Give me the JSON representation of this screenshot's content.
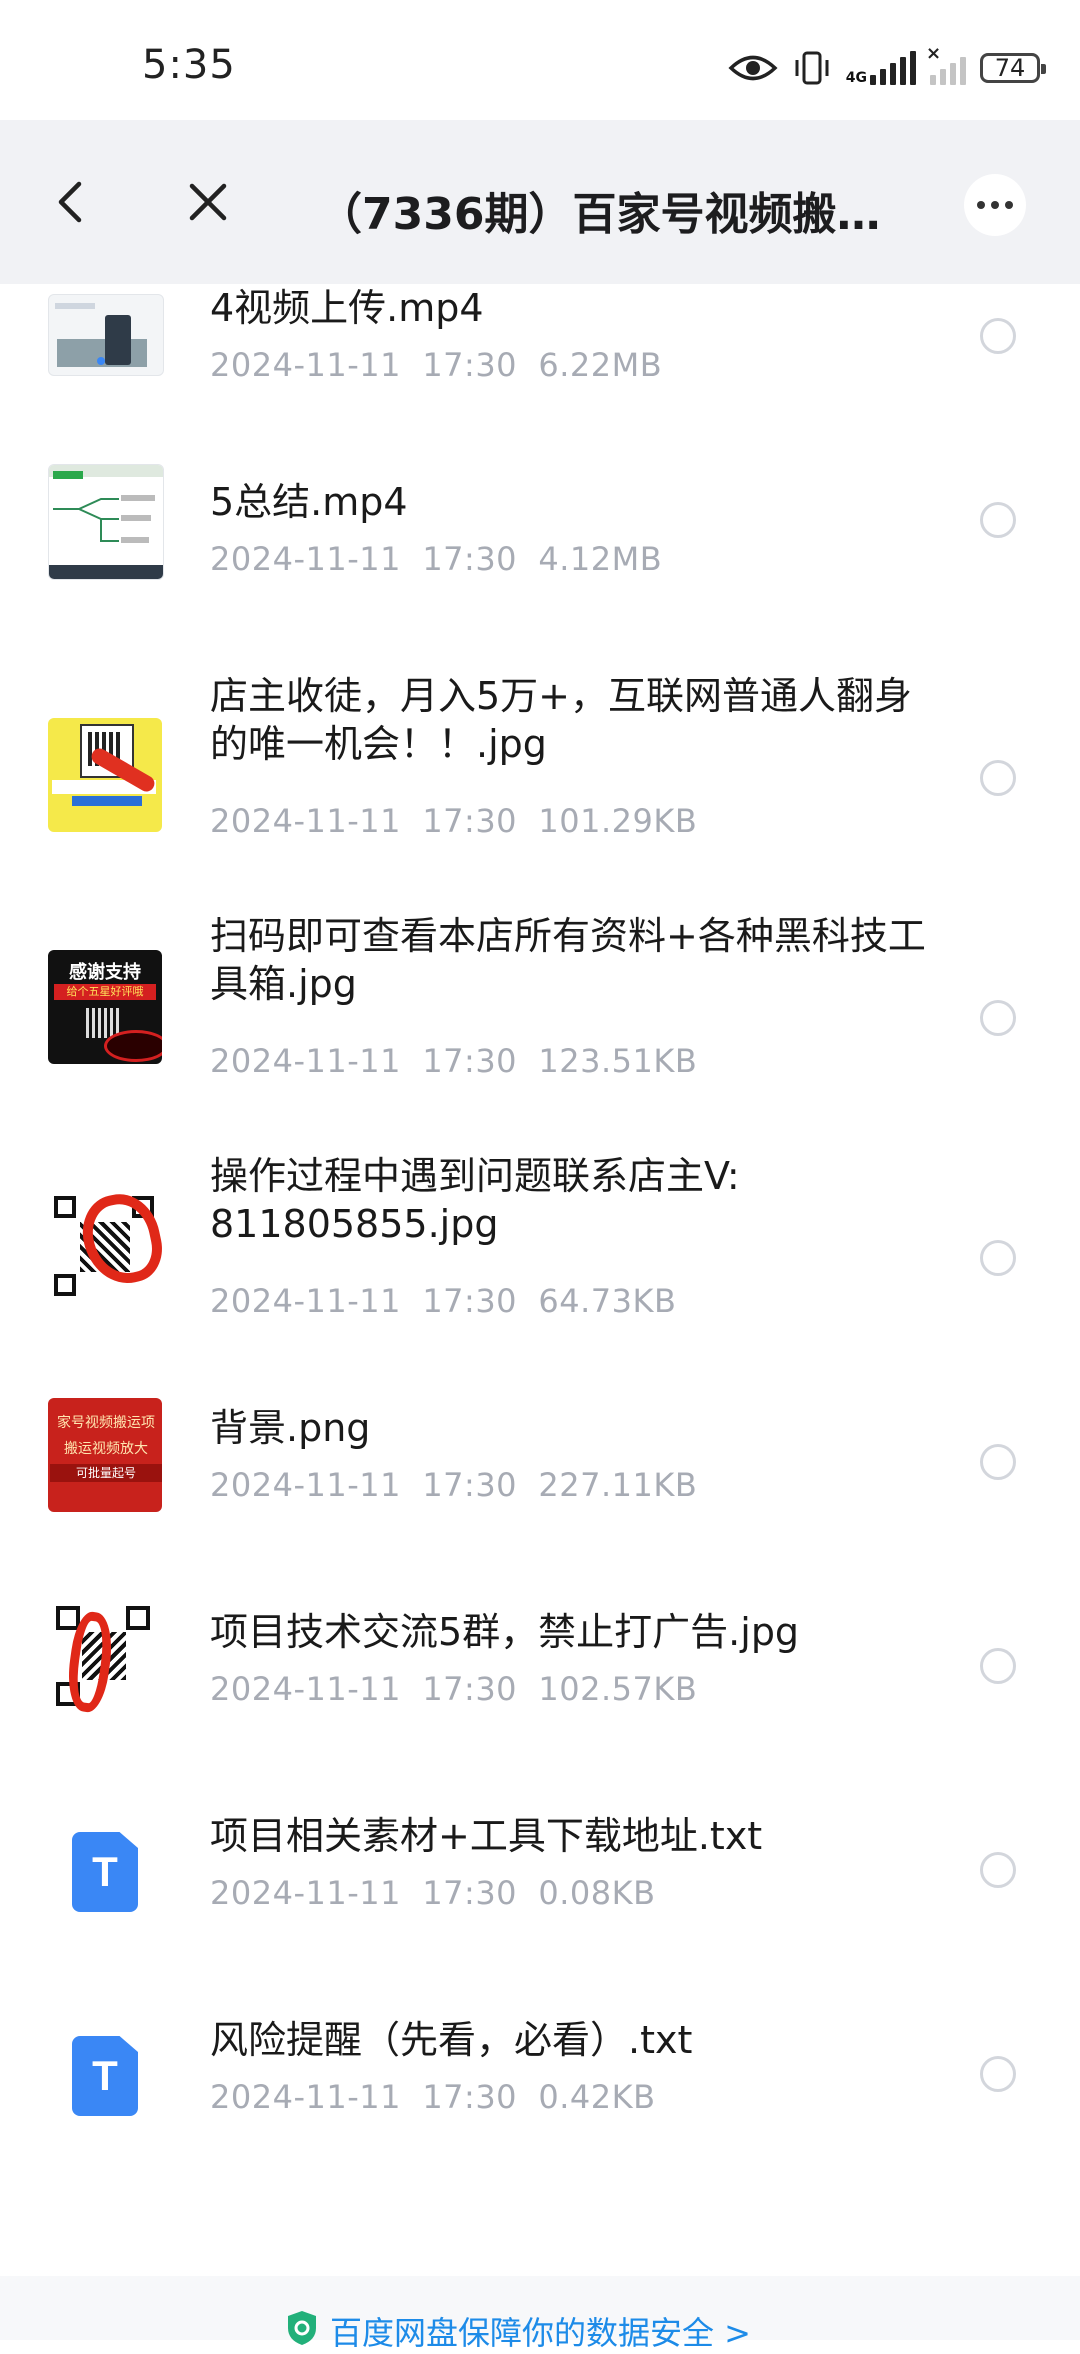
{
  "status": {
    "time": "5:35",
    "network": "4G",
    "battery": "74"
  },
  "header": {
    "title": "（7336期）百家号视频搬运..."
  },
  "files": [
    {
      "name": "4视频上传.mp4",
      "date": "2024-11-11",
      "time": "17:30",
      "size": "6.22MB",
      "thumb": "video-thumbnail"
    },
    {
      "name": "5总结.mp4",
      "date": "2024-11-11",
      "time": "17:30",
      "size": "4.12MB",
      "thumb": "video-thumbnail"
    },
    {
      "name": "店主收徒，月入5万+，互联网普通人翻身的唯一机会！！.jpg",
      "date": "2024-11-11",
      "time": "17:30",
      "size": "101.29KB",
      "thumb": "image-thumbnail"
    },
    {
      "name": "扫码即可查看本店所有资料+各种黑科技工具箱.jpg",
      "date": "2024-11-11",
      "time": "17:30",
      "size": "123.51KB",
      "thumb": "image-thumbnail",
      "thumb_text": [
        "感谢支持",
        "给个五星好评哦"
      ]
    },
    {
      "name": "操作过程中遇到问题联系店主V: 811805855.jpg",
      "date": "2024-11-11",
      "time": "17:30",
      "size": "64.73KB",
      "thumb": "qr-thumbnail"
    },
    {
      "name": "背景.png",
      "date": "2024-11-11",
      "time": "17:30",
      "size": "227.11KB",
      "thumb": "image-thumbnail",
      "thumb_text": [
        "家号视频搬运项",
        "搬运视频放大",
        "可批量起号"
      ]
    },
    {
      "name": "项目技术交流5群，禁止打广告.jpg",
      "date": "2024-11-11",
      "time": "17:30",
      "size": "102.57KB",
      "thumb": "qr-thumbnail"
    },
    {
      "name": "项目相关素材+工具下载地址.txt",
      "date": "2024-11-11",
      "time": "17:30",
      "size": "0.08KB",
      "thumb": "txt-file-icon",
      "icon_letter": "T"
    },
    {
      "name": "风险提醒（先看，必看）.txt",
      "date": "2024-11-11",
      "time": "17:30",
      "size": "0.42KB",
      "thumb": "txt-file-icon",
      "icon_letter": "T"
    }
  ],
  "footer": {
    "text": "百度网盘保障你的数据安全 >"
  },
  "colors": {
    "accent": "#1d8be8",
    "txt_icon": "#3a87f5",
    "meta": "#a7abb4",
    "header_bg": "#f1f2f5"
  }
}
